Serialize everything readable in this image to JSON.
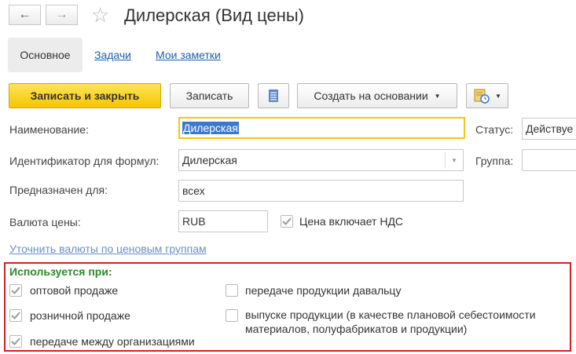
{
  "window": {
    "title": "Дилерская (Вид цены)"
  },
  "nav": {
    "back_label": "←",
    "forward_label": "→",
    "favorite_label": "☆"
  },
  "tabs": [
    {
      "label": "Основное",
      "active": true
    },
    {
      "label": "Задачи",
      "active": false
    },
    {
      "label": "Мои заметки",
      "active": false
    }
  ],
  "toolbar": {
    "save_close_label": "Записать и закрыть",
    "save_label": "Записать",
    "create_based_label": "Создать на основании"
  },
  "form": {
    "name_label": "Наименование:",
    "name_value": "Дилерская",
    "status_label": "Статус:",
    "status_value": "Действуе",
    "id_label": "Идентификатор для формул:",
    "id_value": "Дилерская",
    "group_label": "Группа:",
    "group_value": "",
    "intended_label": "Предназначен для:",
    "intended_value": "всех",
    "currency_label": "Валюта цены:",
    "currency_value": "RUB",
    "vat_label": "Цена включает НДС",
    "vat_checked": true,
    "refine_link": "Уточнить валюты по ценовым группам"
  },
  "usage": {
    "heading": "Используется при:",
    "heading_color": "#2b8a2b",
    "options": [
      {
        "label": "оптовой продаже",
        "checked": true
      },
      {
        "label": "розничной продаже",
        "checked": true
      },
      {
        "label": "передаче между организациями",
        "checked": true
      },
      {
        "label": "передаче продукции давальцу",
        "checked": false
      },
      {
        "label": "выпуске продукции (в качестве плановой себестоимости",
        "label2": "материалов, полуфабрикатов и продукции)",
        "checked": false
      }
    ]
  }
}
